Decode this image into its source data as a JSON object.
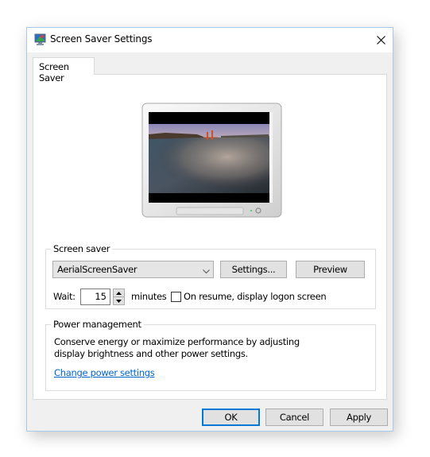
{
  "window": {
    "title": "Screen Saver Settings",
    "icon": "screen-saver-settings-icon",
    "close_icon": "close-icon"
  },
  "tabs": [
    {
      "label": "Screen Saver",
      "selected": true
    }
  ],
  "preview": {
    "description": "Monitor preview showing aerial view of Golden Gate Bridge in fog",
    "icon": "monitor-icon"
  },
  "screen_saver": {
    "group_label": "Screen saver",
    "selected": "AerialScreenSaver",
    "settings_label": "Settings...",
    "preview_label": "Preview",
    "wait_label": "Wait:",
    "wait_value": "15",
    "minutes_label": "minutes",
    "resume_checkbox_label": "On resume, display logon screen",
    "resume_checked": false
  },
  "power": {
    "group_label": "Power management",
    "description": "Conserve energy or maximize performance by adjusting display brightness and other power settings.",
    "link_label": "Change power settings",
    "link_color": "#0066cc"
  },
  "footer": {
    "ok_label": "OK",
    "cancel_label": "Cancel",
    "apply_label": "Apply",
    "accent_color": "#0078d7"
  }
}
